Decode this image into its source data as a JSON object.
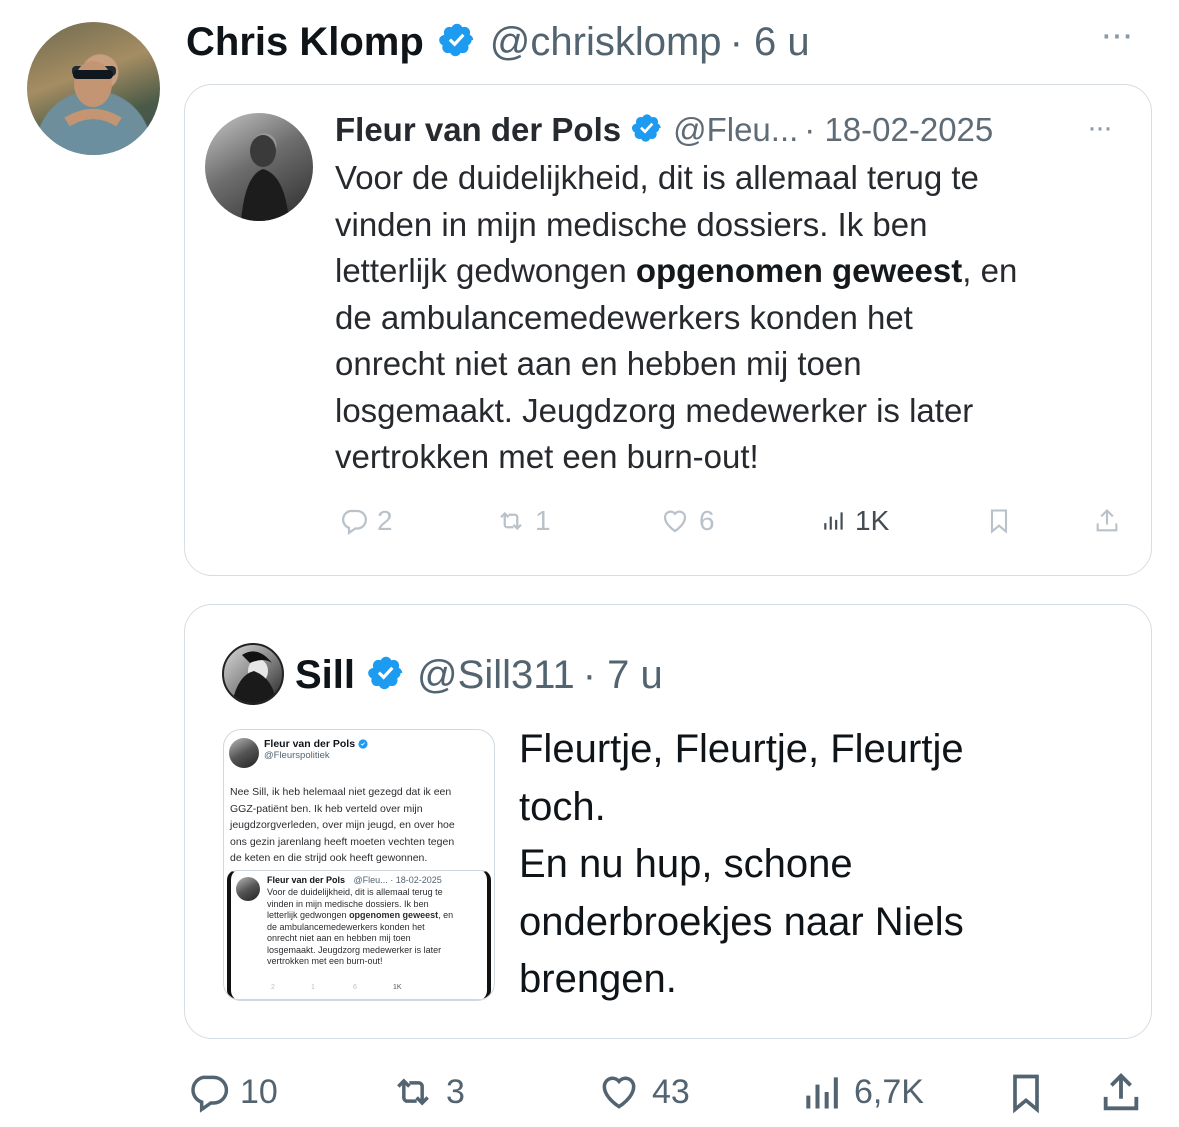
{
  "tweet": {
    "author_name": "Chris Klomp",
    "handle": "@chrisklomp",
    "time": "· 6 u",
    "more": "···"
  },
  "quoted_fleur": {
    "author_name": "Fleur van der Pols",
    "handle": "@Fleu...",
    "date": "· 18-02-2025",
    "more": "···",
    "text_lines": [
      "Voor de duidelijkheid, dit is allemaal terug te",
      "vinden in mijn medische dossiers. Ik ben",
      "letterlijk gedwongen ",
      "opgenomen geweest",
      ", en",
      "de ambulancemedewerkers konden het",
      "onrecht niet aan en hebben mij toen",
      "losgemaakt. Jeugdzorg medewerker is later",
      "vertrokken met een burn-out!"
    ],
    "actions": {
      "replies": "2",
      "reposts": "1",
      "likes": "6",
      "views": "1K"
    }
  },
  "quoted_sill": {
    "author_name": "Sill",
    "handle": "@Sill311",
    "time": "· 7 u",
    "text_lines": [
      "Fleurtje, Fleurtje, Fleurtje",
      "toch.",
      "En nu hup, schone",
      "onderbroekjes naar Niels",
      "brengen."
    ],
    "image": {
      "author_name": "Fleur van der Pols",
      "handle": "@Fleurspolitiek",
      "text_lines": [
        "Nee Sill, ik heb helemaal niet gezegd dat ik een",
        "GGZ-patiënt ben. Ik heb verteld over mijn",
        "jeugdzorgverleden, over mijn jeugd, en over hoe",
        "ons gezin jarenlang heeft moeten vechten tegen",
        "de keten en die strijd ook heeft gewonnen."
      ],
      "inner": {
        "author_name": "Fleur van der Pols",
        "handle_date": "@Fleu... · 18-02-2025",
        "text_lines": [
          "Voor de duidelijkheid, dit is allemaal terug te",
          "vinden in mijn medische dossiers. Ik ben",
          "letterlijk gedwongen ",
          "opgenomen geweest",
          ", en",
          "de ambulancemedewerkers konden het",
          "onrecht niet aan en hebben mij toen",
          "losgemaakt. Jeugdzorg medewerker is later",
          "vertrokken met een burn-out!"
        ],
        "actions": {
          "replies": "2",
          "reposts": "1",
          "likes": "6",
          "views": "1K"
        }
      }
    }
  },
  "actions": {
    "replies": "10",
    "reposts": "3",
    "likes": "43",
    "views": "6,7K"
  },
  "colors": {
    "verified": "#1d9bf0",
    "text": "#0f1419",
    "muted": "#536471",
    "border": "#d6dde3"
  }
}
